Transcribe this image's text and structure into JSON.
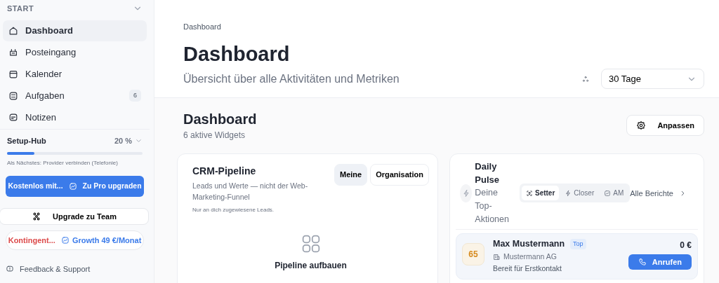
{
  "sidebar": {
    "section_title": "START",
    "items": [
      {
        "label": "Dashboard",
        "selected": true
      },
      {
        "label": "Posteingang",
        "selected": false
      },
      {
        "label": "Kalender",
        "selected": false
      },
      {
        "label": "Aufgaben",
        "selected": false,
        "badge": "6"
      },
      {
        "label": "Notizen",
        "selected": false
      }
    ],
    "setup_hub": {
      "label": "Setup-Hub",
      "percent": "20 %",
      "level": 0.2,
      "next": "Als Nächstes: Provider verbinden (Telefonie)"
    },
    "upgrade_button": {
      "text": "Kostenlos mit...",
      "action": "Zu Pro upgraden"
    },
    "team_button": "Upgrade zu Team",
    "quota": {
      "warning": "Kontingent...",
      "plan": "Growth 49 €/Monat"
    },
    "feedback": "Feedback & Support"
  },
  "header": {
    "breadcrumb": "Dashboard",
    "title": "Dashboard",
    "subtitle": "Übersicht über alle Aktivitäten und Metriken",
    "range": "30 Tage"
  },
  "dashboard": {
    "title": "Dashboard",
    "subtitle": "6 aktive Widgets",
    "customize": "Anpassen"
  },
  "pipeline": {
    "title": "CRM-Pipeline",
    "description": "Leads und Werte — nicht der Web-Marketing-Funnel",
    "note": "Nur an dich zugewiesene Leads.",
    "scopes": [
      {
        "label": "Meine",
        "selected": true
      },
      {
        "label": "Organisation",
        "selected": false
      }
    ],
    "empty_title": "Pipeline aufbauen"
  },
  "pulse": {
    "title": "Daily Pulse",
    "subtitle": "Deine Top-Aktionen",
    "roles": [
      {
        "label": "Setter",
        "selected": true
      },
      {
        "label": "Closer",
        "selected": false
      },
      {
        "label": "AM",
        "selected": false
      }
    ],
    "reports_link": "Alle Berichte",
    "lead": {
      "score": "65",
      "name": "Max Mustermann",
      "tag": "Top",
      "company": "Mustermann AG",
      "status": "Bereit für Erstkontakt",
      "value": "0 €",
      "call": "Anrufen"
    }
  }
}
